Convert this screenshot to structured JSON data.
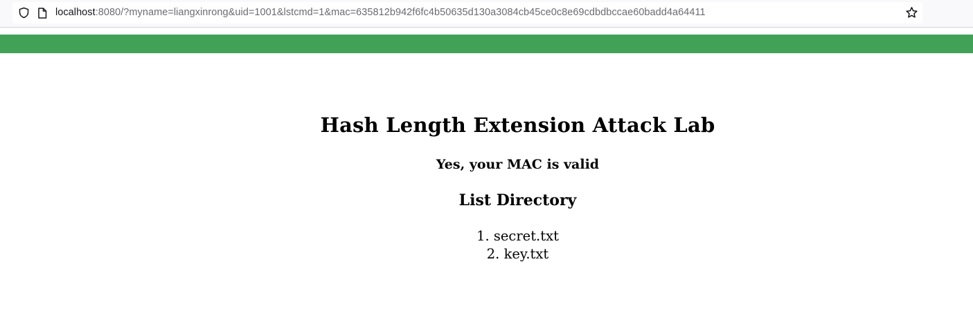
{
  "browser": {
    "url_host": "localhost",
    "url_rest": ":8080/?myname=liangxinrong&uid=1001&lstcmd=1&mac=635812b942f6fc4b50635d130a3084cb45ce0c8e69cdbdbccae60badd4a64411",
    "icons": [
      "shield-icon",
      "page-icon",
      "star-icon"
    ]
  },
  "banner": {
    "color": "#41a257"
  },
  "page": {
    "title": "Hash Length Extension Attack Lab",
    "status": "Yes, your MAC is valid",
    "list_heading": "List Directory",
    "files": [
      {
        "number": "1.",
        "name": "secret.txt"
      },
      {
        "number": "2.",
        "name": "key.txt"
      }
    ]
  }
}
